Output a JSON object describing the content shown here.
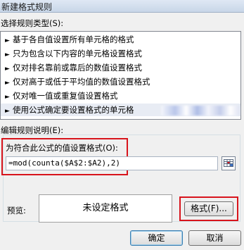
{
  "window": {
    "title": "新建格式规则"
  },
  "rule_type": {
    "label": "选择规则类型(S):",
    "items": [
      "基于各自值设置所有单元格的格式",
      "只为包含以下内容的单元格设置格式",
      "仅对排名靠前或靠后的数值设置格式",
      "仅对高于或低于平均值的数值设置格式",
      "仅对唯一值或重复值设置格式",
      "使用公式确定要设置格式的单元格"
    ],
    "selected_index": 5,
    "arrow_glyph": "►"
  },
  "edit": {
    "label": "编辑规则说明(E):",
    "formula_label": "为符合此公式的值设置格式(O):",
    "formula_value": "=mod(counta($A$2:$A2),2)"
  },
  "preview": {
    "label": "预览:",
    "text": "未设定格式"
  },
  "buttons": {
    "format": "格式(F)...",
    "ok": "确定",
    "cancel": "取消"
  },
  "colors": {
    "highlight_red": "#d8141c",
    "selected_row": "#e8ecf4"
  }
}
